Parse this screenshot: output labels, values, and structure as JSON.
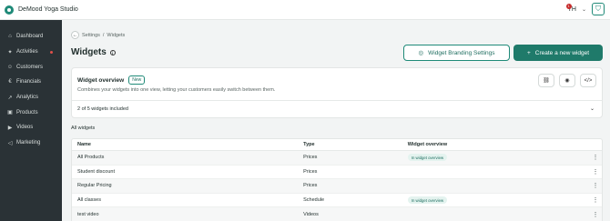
{
  "app": {
    "title": "DeMood Yoga Studio"
  },
  "user": {
    "initials": "TH",
    "notifications": "1"
  },
  "sidebar": {
    "items": [
      {
        "label": "Dashboard",
        "icon": "home-icon",
        "glyph": "⌂",
        "dot": false
      },
      {
        "label": "Activities",
        "icon": "activities-icon",
        "glyph": "✦",
        "dot": true
      },
      {
        "label": "Customers",
        "icon": "user-icon",
        "glyph": "☺",
        "dot": false
      },
      {
        "label": "Financials",
        "icon": "euro-icon",
        "glyph": "€",
        "dot": false
      },
      {
        "label": "Analytics",
        "icon": "analytics-icon",
        "glyph": "↗",
        "dot": false
      },
      {
        "label": "Products",
        "icon": "products-icon",
        "glyph": "▣",
        "dot": false
      },
      {
        "label": "Videos",
        "icon": "video-icon",
        "glyph": "▶",
        "dot": false
      },
      {
        "label": "Marketing",
        "icon": "megaphone-icon",
        "glyph": "◁",
        "dot": false
      }
    ]
  },
  "breadcrumb": {
    "parent": "Settings",
    "separator": "/",
    "current": "Widgets"
  },
  "page": {
    "title": "Widgets",
    "branding_button": "Widget Branding Settings",
    "create_button": "Create a new widget"
  },
  "overview": {
    "title": "Widget overview",
    "badge": "New",
    "description": "Combines your widgets into one view, letting your customers easily switch between them.",
    "included": "2 of 5 widgets included"
  },
  "table": {
    "section_label": "All widgets",
    "columns": [
      "Name",
      "Type",
      "Widget overview"
    ],
    "rows": [
      {
        "name": "All Products",
        "type": "Prices",
        "overview": "In widget overview"
      },
      {
        "name": "Student discount",
        "type": "Prices",
        "overview": ""
      },
      {
        "name": "Regular Pricing",
        "type": "Prices",
        "overview": ""
      },
      {
        "name": "All classes",
        "type": "Schedule",
        "overview": "In widget overview"
      },
      {
        "name": "test video",
        "type": "Videos",
        "overview": ""
      }
    ]
  },
  "colors": {
    "accent": "#1f7a6a",
    "sidebar": "#2a3236",
    "notification": "#c62b2b"
  }
}
